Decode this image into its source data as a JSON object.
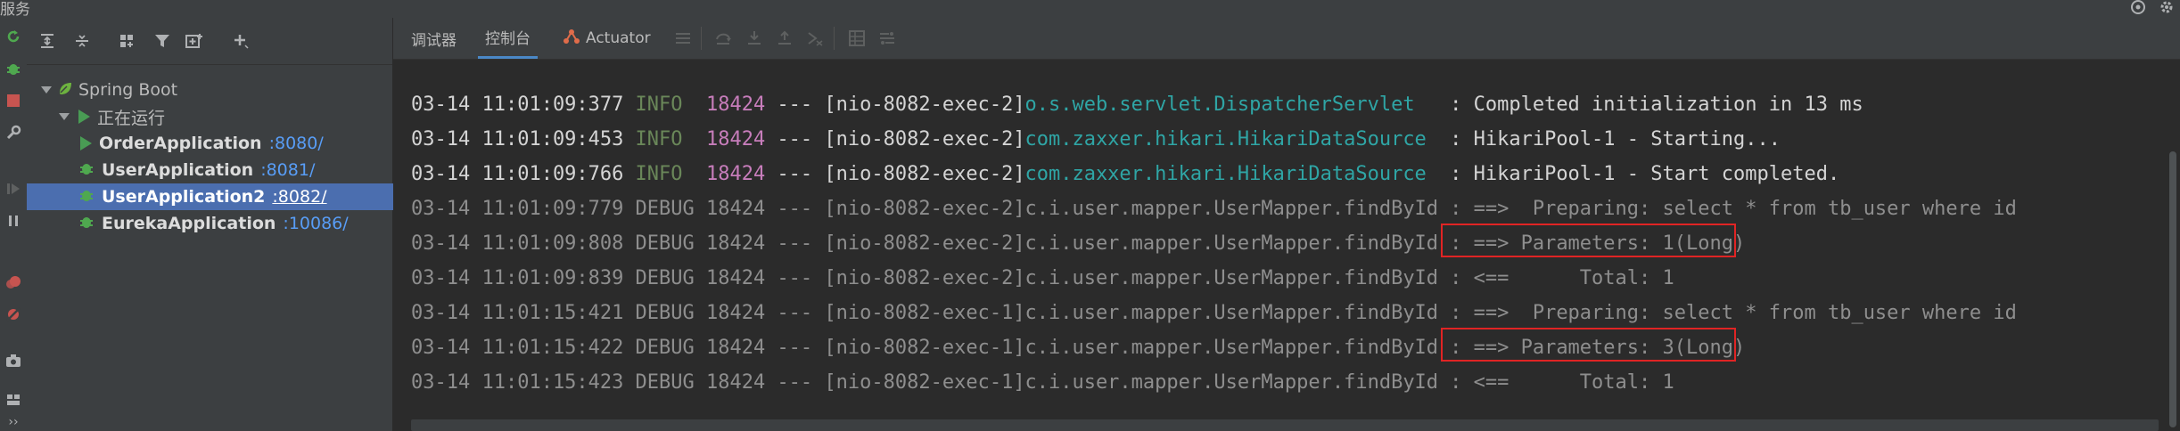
{
  "window": {
    "title": "服务"
  },
  "colors": {
    "accent": "#4b6eaf",
    "run": "#499c54",
    "debug_green": "#4fa84f",
    "highlight": "#e02424",
    "stop": "#c75450"
  },
  "icons": {
    "title_bar": [
      "settings-wheel-icon",
      "gear-icon"
    ],
    "left_strip": [
      "rerun-icon",
      "debug-bug-icon",
      "stop-icon",
      "wrench-icon",
      "resume-icon",
      "pause-icon",
      "breakpoint-icon",
      "mute-breakpoints-icon",
      "camera-icon",
      "layout-icon",
      "more-icon"
    ],
    "services_toolbar": [
      "expand-all-icon",
      "collapse-all-icon",
      "group-by-icon",
      "filter-icon",
      "new-tab-icon",
      "add-icon"
    ],
    "console_toolbar": [
      "menu-lines-icon",
      "step-over-icon",
      "step-into-icon",
      "step-out-icon",
      "run-to-cursor-icon",
      "table-icon",
      "evaluate-icon"
    ]
  },
  "services": {
    "tree": {
      "root": "Spring Boot",
      "group": "正在运行",
      "apps": [
        {
          "name": "OrderApplication",
          "port": ":8080/",
          "state": "run"
        },
        {
          "name": "UserApplication",
          "port": ":8081/",
          "state": "debug"
        },
        {
          "name": "UserApplication2",
          "port": ":8082/",
          "state": "debug",
          "selected": true
        },
        {
          "name": "EurekaApplication",
          "port": ":10086/",
          "state": "debug"
        }
      ]
    }
  },
  "console": {
    "tabs": [
      {
        "label": "调试器",
        "active": false
      },
      {
        "label": "控制台",
        "active": true
      },
      {
        "label": "Actuator",
        "active": false
      }
    ],
    "log_lines": [
      {
        "ts": "03-14 11:01:09:377",
        "level": "INFO",
        "pid": "18424",
        "sep": "---",
        "thread": "[nio-8082-exec-2]",
        "logger": "o.s.web.servlet.DispatcherServlet",
        "msg": ": Completed initialization in 13 ms",
        "highlight": false
      },
      {
        "ts": "03-14 11:01:09:453",
        "level": "INFO",
        "pid": "18424",
        "sep": "---",
        "thread": "[nio-8082-exec-2]",
        "logger": "com.zaxxer.hikari.HikariDataSource",
        "msg": ": HikariPool-1 - Starting...",
        "highlight": false
      },
      {
        "ts": "03-14 11:01:09:766",
        "level": "INFO",
        "pid": "18424",
        "sep": "---",
        "thread": "[nio-8082-exec-2]",
        "logger": "com.zaxxer.hikari.HikariDataSource",
        "msg": ": HikariPool-1 - Start completed.",
        "highlight": false
      },
      {
        "ts": "03-14 11:01:09:779",
        "level": "DEBUG",
        "pid": "18424",
        "sep": "---",
        "thread": "[nio-8082-exec-2]",
        "logger": "c.i.user.mapper.UserMapper.findById",
        "msg": ": ==>  Preparing: select * from tb_user where id",
        "highlight": false
      },
      {
        "ts": "03-14 11:01:09:808",
        "level": "DEBUG",
        "pid": "18424",
        "sep": "---",
        "thread": "[nio-8082-exec-2]",
        "logger": "c.i.user.mapper.UserMapper.findById",
        "msg": ": ==> Parameters: 1(Long)",
        "highlight": true
      },
      {
        "ts": "03-14 11:01:09:839",
        "level": "DEBUG",
        "pid": "18424",
        "sep": "---",
        "thread": "[nio-8082-exec-2]",
        "logger": "c.i.user.mapper.UserMapper.findById",
        "msg": ": <==      Total: 1",
        "highlight": false
      },
      {
        "ts": "03-14 11:01:15:421",
        "level": "DEBUG",
        "pid": "18424",
        "sep": "---",
        "thread": "[nio-8082-exec-1]",
        "logger": "c.i.user.mapper.UserMapper.findById",
        "msg": ": ==>  Preparing: select * from tb_user where id",
        "highlight": false
      },
      {
        "ts": "03-14 11:01:15:422",
        "level": "DEBUG",
        "pid": "18424",
        "sep": "---",
        "thread": "[nio-8082-exec-1]",
        "logger": "c.i.user.mapper.UserMapper.findById",
        "msg": ": ==> Parameters: 3(Long)",
        "highlight": true
      },
      {
        "ts": "03-14 11:01:15:423",
        "level": "DEBUG",
        "pid": "18424",
        "sep": "---",
        "thread": "[nio-8082-exec-1]",
        "logger": "c.i.user.mapper.UserMapper.findById",
        "msg": ": <==      Total: 1",
        "highlight": false
      }
    ]
  }
}
